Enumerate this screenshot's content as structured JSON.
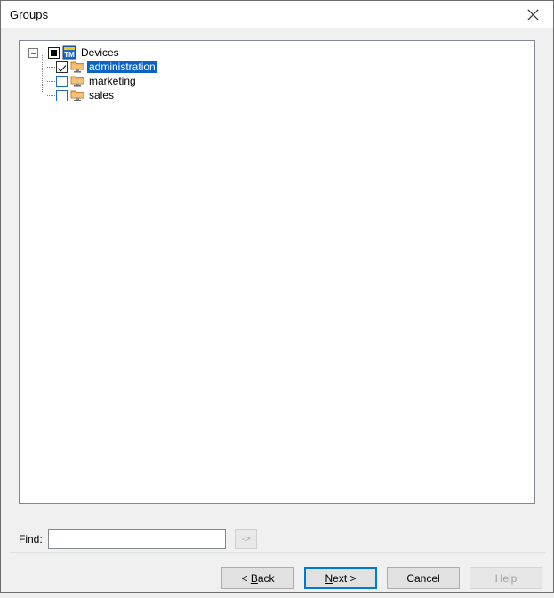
{
  "window": {
    "title": "Groups",
    "close_icon": "close-icon"
  },
  "tree": {
    "root": {
      "label": "Devices",
      "icon": "tm-device-manager-icon",
      "checkbox_state": "indeterminate",
      "expander_state": "expanded",
      "expander_glyph": "minus"
    },
    "children": [
      {
        "label": "administration",
        "icon": "group-folder-icon",
        "checkbox_state": "checked",
        "selected": true
      },
      {
        "label": "marketing",
        "icon": "group-folder-icon",
        "checkbox_state": "unchecked",
        "selected": false
      },
      {
        "label": "sales",
        "icon": "group-folder-icon",
        "checkbox_state": "unchecked",
        "selected": false
      }
    ]
  },
  "find": {
    "label": "Find:",
    "value": "",
    "placeholder": "",
    "go_label": "->",
    "go_enabled": false
  },
  "footer": {
    "back_label": "< Back",
    "back_accel": "B",
    "next_label": "Next >",
    "next_accel": "N",
    "cancel_label": "Cancel",
    "help_label": "Help",
    "help_enabled": false,
    "default_button": "next"
  },
  "colors": {
    "selection_blue": "#0a64c8",
    "focus_blue": "#0078d7",
    "folder_orange": "#e8a33d",
    "panel_border": "#828790",
    "dialog_bg": "#f0f0f0",
    "titlebar_bg": "#ffffff"
  }
}
